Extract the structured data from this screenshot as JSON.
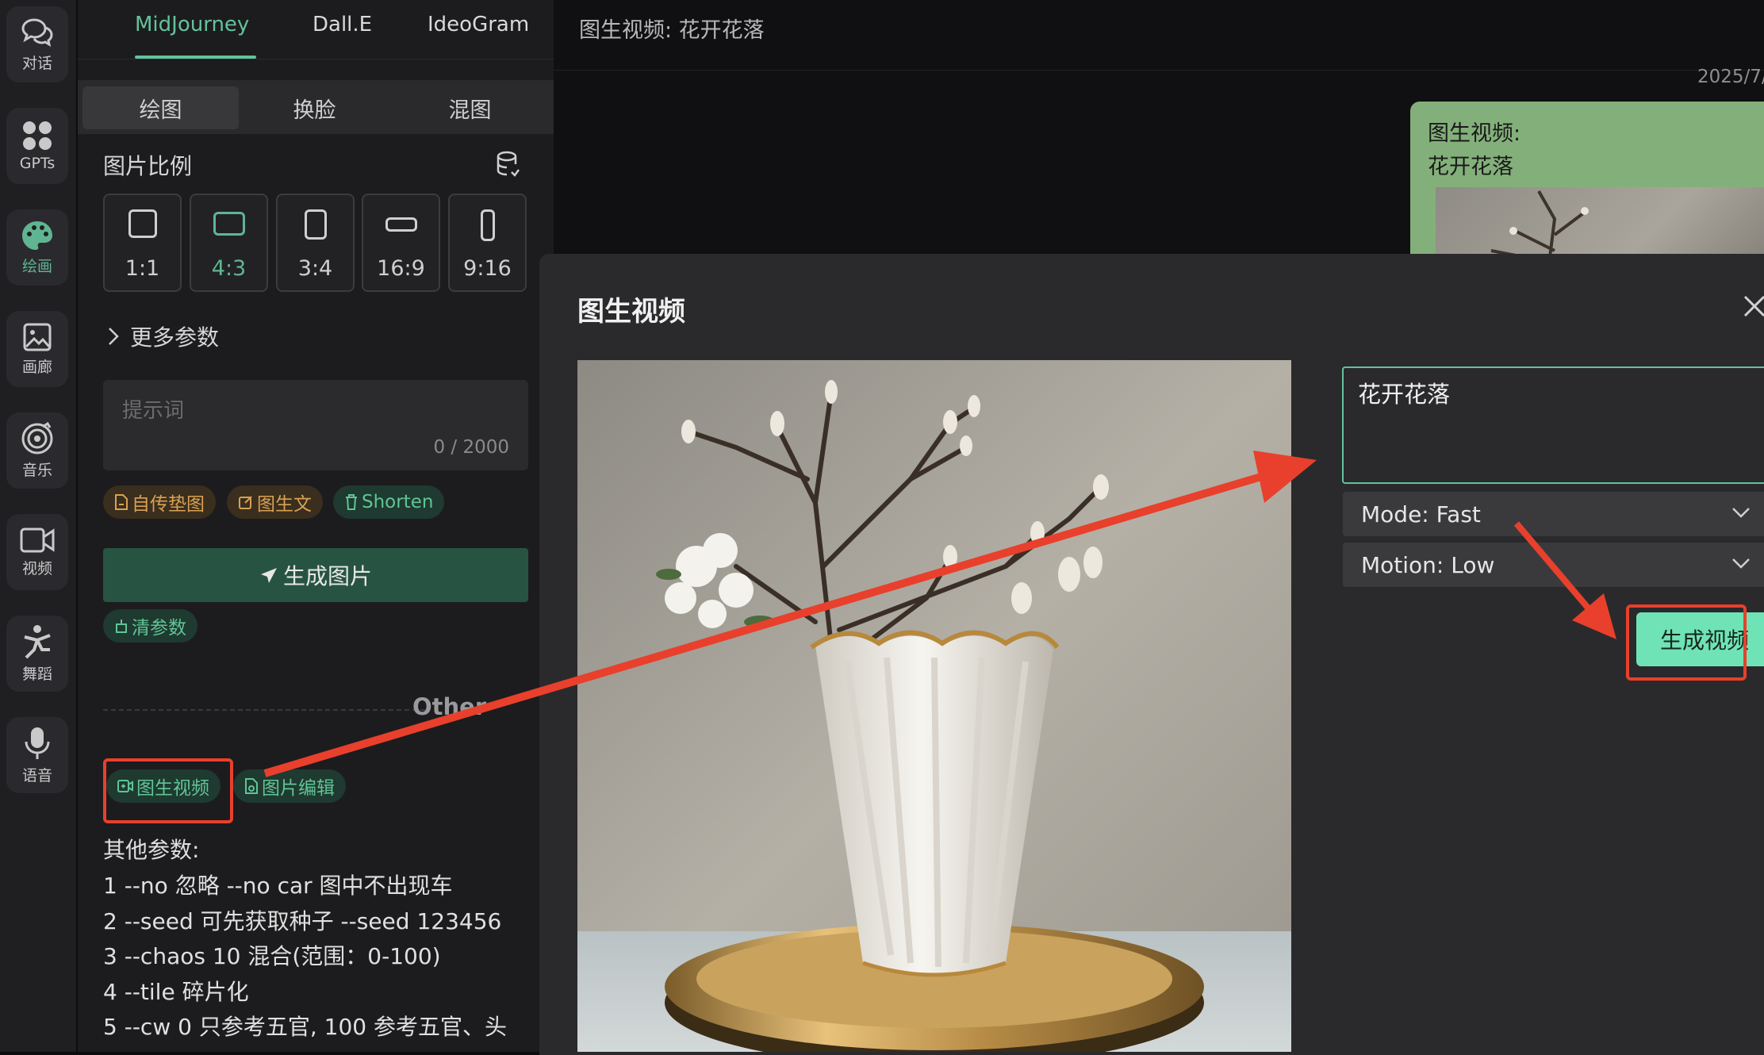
{
  "rail": [
    {
      "label": "对话",
      "icon": "chat-icon",
      "active": false
    },
    {
      "label": "GPTs",
      "icon": "gpts-grid-icon",
      "active": false
    },
    {
      "label": "绘画",
      "icon": "palette-icon",
      "active": true
    },
    {
      "label": "画廊",
      "icon": "gallery-icon",
      "active": false
    },
    {
      "label": "音乐",
      "icon": "music-icon",
      "active": false
    },
    {
      "label": "视频",
      "icon": "video-icon",
      "active": false
    },
    {
      "label": "舞蹈",
      "icon": "dance-icon",
      "active": false
    },
    {
      "label": "语音",
      "icon": "microphone-icon",
      "active": false
    }
  ],
  "panel": {
    "model_tabs": [
      "MidJourney",
      "Dall.E",
      "IdeoGram"
    ],
    "active_model_tab": "MidJourney",
    "sub_tabs": [
      "绘图",
      "换脸",
      "混图"
    ],
    "active_sub_tab": "绘图",
    "ratio_title": "图片比例",
    "ratios": [
      "1:1",
      "4:3",
      "3:4",
      "16:9",
      "9:16"
    ],
    "active_ratio": "4:3",
    "more_params": "更多参数",
    "prompt_placeholder": "提示词",
    "prompt_count": "0 / 2000",
    "chips": [
      "自传垫图",
      "图生文",
      "Shorten"
    ],
    "generate_button": "生成图片",
    "clear_params": "清参数",
    "other_label": "Other",
    "tools": [
      "图生视频",
      "图片编辑"
    ],
    "other_params_title": "其他参数:",
    "other_params": [
      "1 --no 忽略 --no car 图中不出现车",
      "2 --seed 可先获取种子 --seed 123456",
      "3 --chaos 10 混合(范围：0-100)",
      "4 --tile 碎片化",
      "5 --cw 0 只参考五官, 100 参考五官、头"
    ]
  },
  "chat": {
    "header_title": "图生视频: 花开花落",
    "timestamp": "2025/7/",
    "bubble_line1": "图生视频:",
    "bubble_line2": "花开花落"
  },
  "modal": {
    "title": "图生视频",
    "prompt_value": "花开花落",
    "mode_select": "Mode: Fast",
    "motion_select": "Motion: Low",
    "generate_video_button": "生成视频"
  },
  "colors": {
    "accent_green": "#63c29b",
    "annotation_red": "#e8402c",
    "generate_button_bg": "#275442",
    "video_button_bg": "#6fe3b6"
  }
}
